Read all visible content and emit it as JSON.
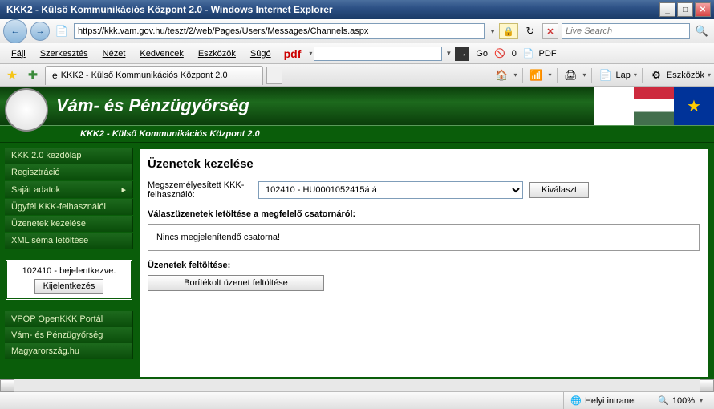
{
  "window": {
    "title": "KKK2 - Külső Kommunikációs Központ 2.0 - Windows Internet Explorer"
  },
  "address": {
    "url": "https://kkk.vam.gov.hu/teszt/2/web/Pages/Users/Messages/Channels.aspx",
    "search_placeholder": "Live Search"
  },
  "menu": {
    "items": [
      "Fájl",
      "Szerkesztés",
      "Nézet",
      "Kedvencek",
      "Eszközök",
      "Súgó"
    ],
    "pdf_label": "pdf",
    "go_label": "Go",
    "pdf_btn": "PDF",
    "blocker": "0"
  },
  "tab": {
    "title": "KKK2 - Külső Kommunikációs Központ 2.0"
  },
  "toolbtns": {
    "lap": "Lap",
    "tools": "Eszközök"
  },
  "page": {
    "org": "Vám- és Pénzügyőrség",
    "subtitle": "KKK2 - Külső Kommunikációs Központ 2.0"
  },
  "sidebar": {
    "items": [
      {
        "label": "KKK 2.0 kezdőlap",
        "exp": false
      },
      {
        "label": "Regisztráció",
        "exp": false
      },
      {
        "label": "Saját adatok",
        "exp": true
      },
      {
        "label": "Ügyfél KKK-felhasználói",
        "exp": false
      },
      {
        "label": "Üzenetek kezelése",
        "exp": false
      },
      {
        "label": "XML séma letöltése",
        "exp": false
      }
    ],
    "login_status": "102410 - bejelentkezve.",
    "logout": "Kijelentkezés",
    "footer": [
      {
        "label": "VPOP OpenKKK Portál"
      },
      {
        "label": "Vám- és Pénzügyőrség"
      },
      {
        "label": "Magyarország.hu"
      }
    ]
  },
  "main": {
    "heading": "Üzenetek kezelése",
    "user_label": "Megszemélyesített KKK-felhasználó:",
    "user_value": "102410 - HU0001052415á á",
    "select_btn": "Kiválaszt",
    "download_heading": "Válaszüzenetek letöltése a megfelelő csatornáról:",
    "no_channel": "Nincs megjelenítendő csatorna!",
    "upload_heading": "Üzenetek feltöltése:",
    "upload_btn": "Borítékolt üzenet feltöltése"
  },
  "status": {
    "zone": "Helyi intranet",
    "zoom": "100%"
  }
}
